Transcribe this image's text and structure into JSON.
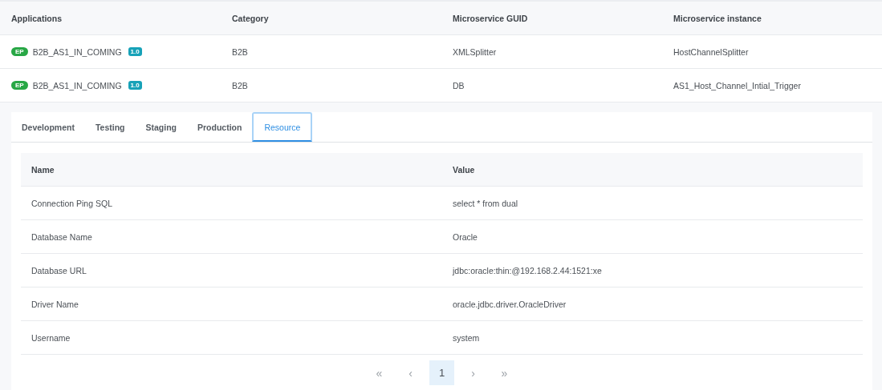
{
  "apps_table": {
    "columns": [
      "Applications",
      "Category",
      "Microservice GUID",
      "Microservice instance"
    ],
    "rows": [
      {
        "badge": "EP",
        "name": "B2B_AS1_IN_COMING",
        "version": "1.0",
        "category": "B2B",
        "guid": "XMLSplitter",
        "instance": "HostChannelSplitter"
      },
      {
        "badge": "EP",
        "name": "B2B_AS1_IN_COMING",
        "version": "1.0",
        "category": "B2B",
        "guid": "DB",
        "instance": "AS1_Host_Channel_Intial_Trigger"
      }
    ]
  },
  "tabs": [
    {
      "label": "Development",
      "selected": false
    },
    {
      "label": "Testing",
      "selected": false
    },
    {
      "label": "Staging",
      "selected": false
    },
    {
      "label": "Production",
      "selected": false
    },
    {
      "label": "Resource",
      "selected": true
    }
  ],
  "resource_table": {
    "columns": [
      "Name",
      "Value"
    ],
    "rows": [
      {
        "name": "Connection Ping SQL",
        "value": "select * from dual"
      },
      {
        "name": "Database Name",
        "value": "Oracle"
      },
      {
        "name": "Database URL",
        "value": "jdbc:oracle:thin:@192.168.2.44:1521:xe"
      },
      {
        "name": "Driver Name",
        "value": "oracle.jdbc.driver.OracleDriver"
      },
      {
        "name": "Username",
        "value": "system"
      }
    ]
  },
  "pagination": [
    {
      "label": "«",
      "selected": false
    },
    {
      "label": "‹",
      "selected": false
    },
    {
      "label": "1",
      "selected": true
    },
    {
      "label": "›",
      "selected": false
    },
    {
      "label": "»",
      "selected": false
    }
  ]
}
